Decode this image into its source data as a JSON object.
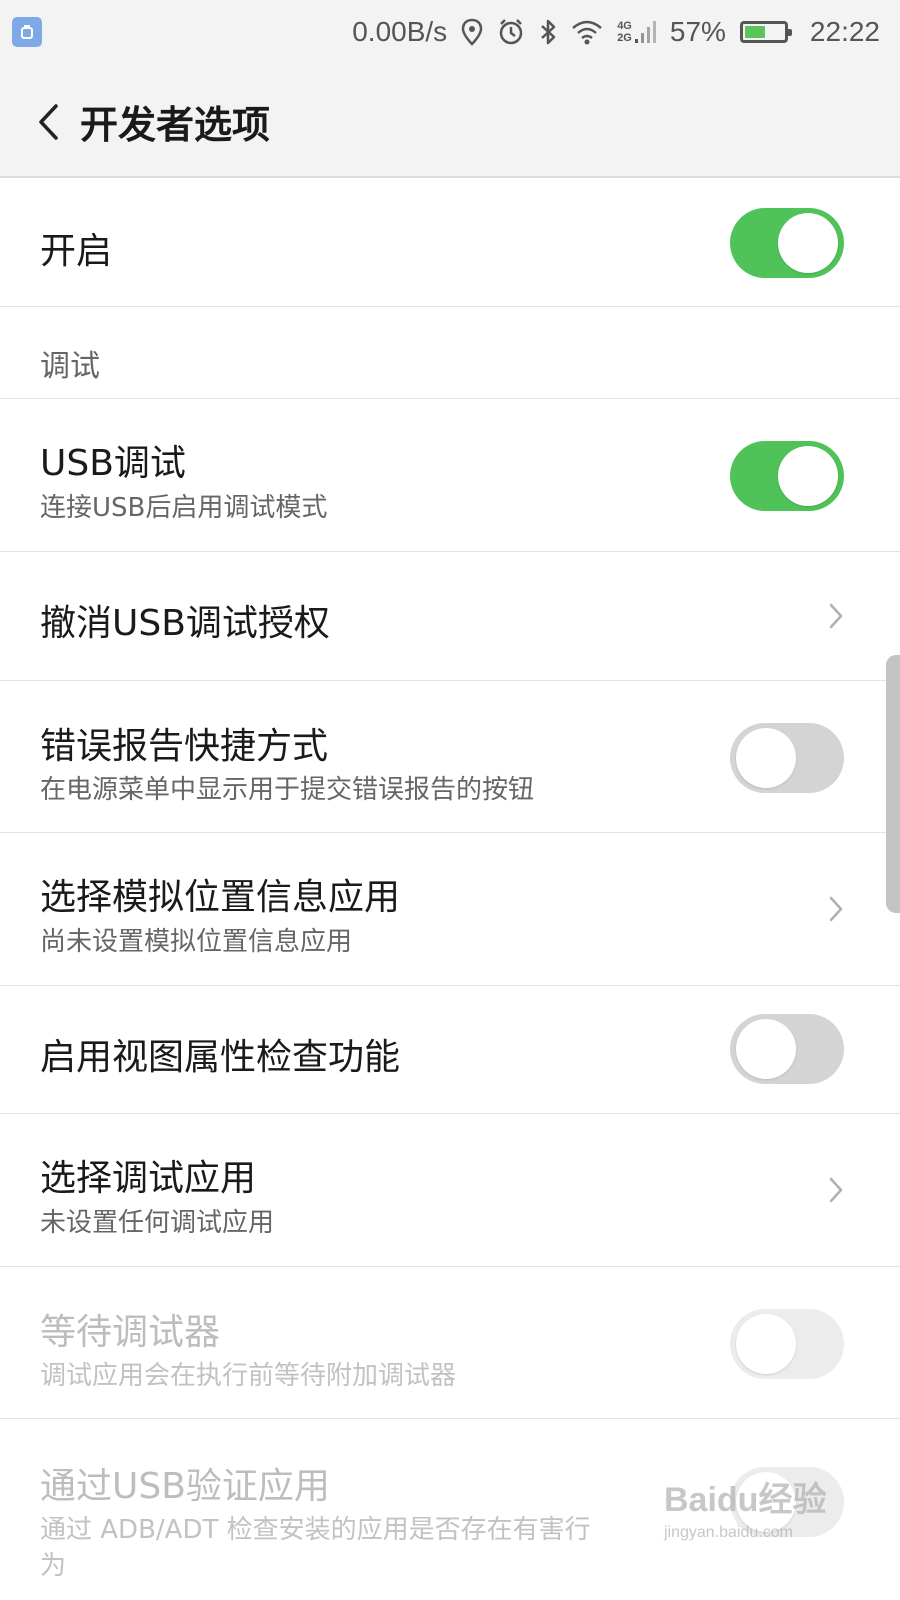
{
  "status_bar": {
    "net_speed": "0.00B/s",
    "net_type_top": "4G",
    "net_type_bottom": "2G",
    "battery": "57%",
    "battery_level": 0.57,
    "time": "22:22",
    "icons": [
      "app-notification-icon",
      "location-icon",
      "alarm-icon",
      "bluetooth-icon",
      "wifi-icon",
      "signal-icon",
      "battery-icon"
    ]
  },
  "header": {
    "title": "开发者选项",
    "back_icon": "back-chevron-icon"
  },
  "colors": {
    "toggle_on": "#4fc35a",
    "toggle_off": "#d4d4d4",
    "background": "#ffffff",
    "header_bg": "#f3f3f3"
  },
  "settings": {
    "master": {
      "title": "开启",
      "enabled": true
    },
    "section_debug": "调试",
    "usb_debug": {
      "title": "USB调试",
      "subtitle": "连接USB后启用调试模式",
      "enabled": true
    },
    "revoke_usb": {
      "title": "撤消USB调试授权"
    },
    "bug_report": {
      "title": "错误报告快捷方式",
      "subtitle": "在电源菜单中显示用于提交错误报告的按钮",
      "enabled": false
    },
    "mock_location": {
      "title": "选择模拟位置信息应用",
      "subtitle": "尚未设置模拟位置信息应用"
    },
    "view_attr": {
      "title": "启用视图属性检查功能",
      "enabled": false
    },
    "debug_app": {
      "title": "选择调试应用",
      "subtitle": "未设置任何调试应用"
    },
    "wait_debugger": {
      "title": "等待调试器",
      "subtitle": "调试应用会在执行前等待附加调试器",
      "enabled": false,
      "disabled": true
    },
    "verify_usb": {
      "title": "通过USB验证应用",
      "subtitle_line1": "通过 ADB/ADT 检查安装的应用是否存在有害行",
      "subtitle_line2": "为",
      "disabled": true
    }
  },
  "watermark": {
    "text": "Baidu经验",
    "url": "jingyan.baidu.com"
  }
}
